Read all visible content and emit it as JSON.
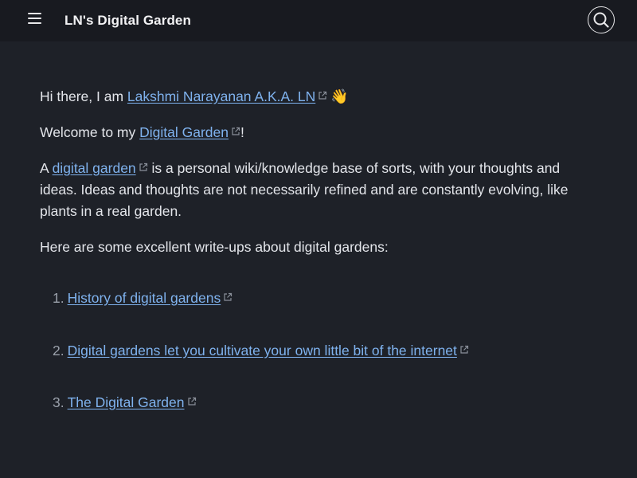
{
  "header": {
    "title": "LN's Digital Garden",
    "menu_icon": "menu-icon",
    "search_icon": "search-icon"
  },
  "intro": {
    "greeting_prefix": "Hi there, I am ",
    "author_link": "Lakshmi Narayanan A.K.A. LN",
    "wave_emoji": "👋",
    "welcome_prefix": "Welcome to my ",
    "welcome_link": "Digital Garden",
    "welcome_suffix": "!",
    "def_prefix": "A ",
    "def_link": "digital garden",
    "def_suffix": " is a personal wiki/knowledge base of sorts, with your thoughts and ideas. Ideas and thoughts are not necessarily refined and are constantly evolving, like plants in a real garden.",
    "writeups_heading": "Here are some excellent write-ups about digital gardens:"
  },
  "writeups": [
    {
      "number": "1.",
      "label": "History of digital gardens"
    },
    {
      "number": "2.",
      "label": "Digital gardens let you cultivate your own little bit of the internet"
    },
    {
      "number": "3.",
      "label": "The Digital Garden"
    }
  ],
  "colors": {
    "background": "#1e2128",
    "header": "#181a20",
    "link": "#7fb2ee",
    "text": "#e3e5ea"
  }
}
